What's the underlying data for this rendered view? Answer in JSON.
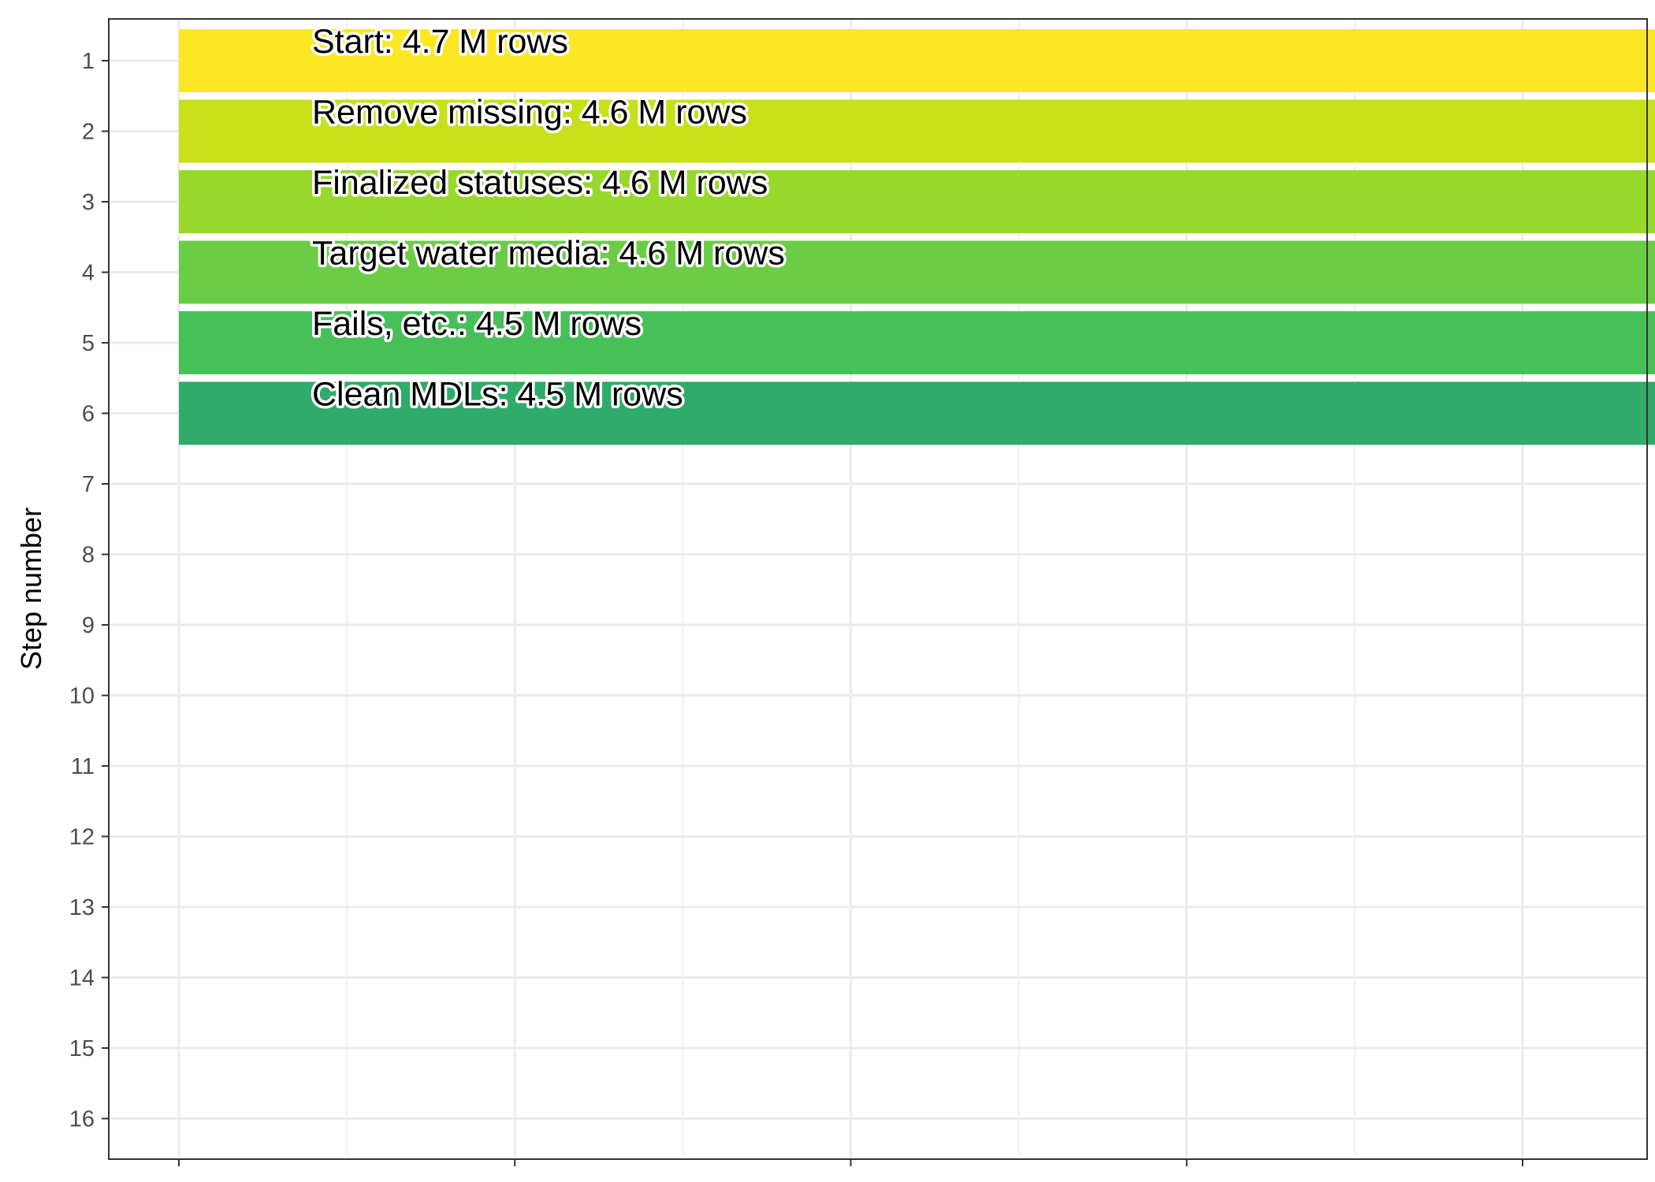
{
  "chart_data": {
    "type": "bar",
    "orientation": "horizontal",
    "title": "",
    "xlabel": "",
    "ylabel": "Step number",
    "y_categories": [
      "1",
      "2",
      "3",
      "4",
      "5",
      "6",
      "7",
      "8",
      "9",
      "10",
      "11",
      "12",
      "13",
      "14",
      "15",
      "16"
    ],
    "xlim": [
      0,
      4.9
    ],
    "x_ticks": [
      0,
      1,
      2,
      3,
      4
    ],
    "x_tick_labels_shown": false,
    "grid": true,
    "legend": "none",
    "bars": [
      {
        "step": 1,
        "label": "Start:  4.7 M rows",
        "value": 4.7,
        "color": "#FDE725"
      },
      {
        "step": 2,
        "label": "Remove missing:  4.6 M rows",
        "value": 4.653,
        "color": "#C8E01A"
      },
      {
        "step": 3,
        "label": "Finalized statuses:  4.6 M rows",
        "value": 4.617,
        "color": "#98D82C"
      },
      {
        "step": 4,
        "label": "Target water media:  4.6 M rows",
        "value": 4.614,
        "color": "#6BCD45"
      },
      {
        "step": 5,
        "label": "Fails, etc.:  4.5 M rows",
        "value": 4.533,
        "color": "#48C05A"
      },
      {
        "step": 6,
        "label": "Clean MDLs:  4.5 M rows",
        "value": 4.532,
        "color": "#2FAB6A"
      }
    ]
  }
}
